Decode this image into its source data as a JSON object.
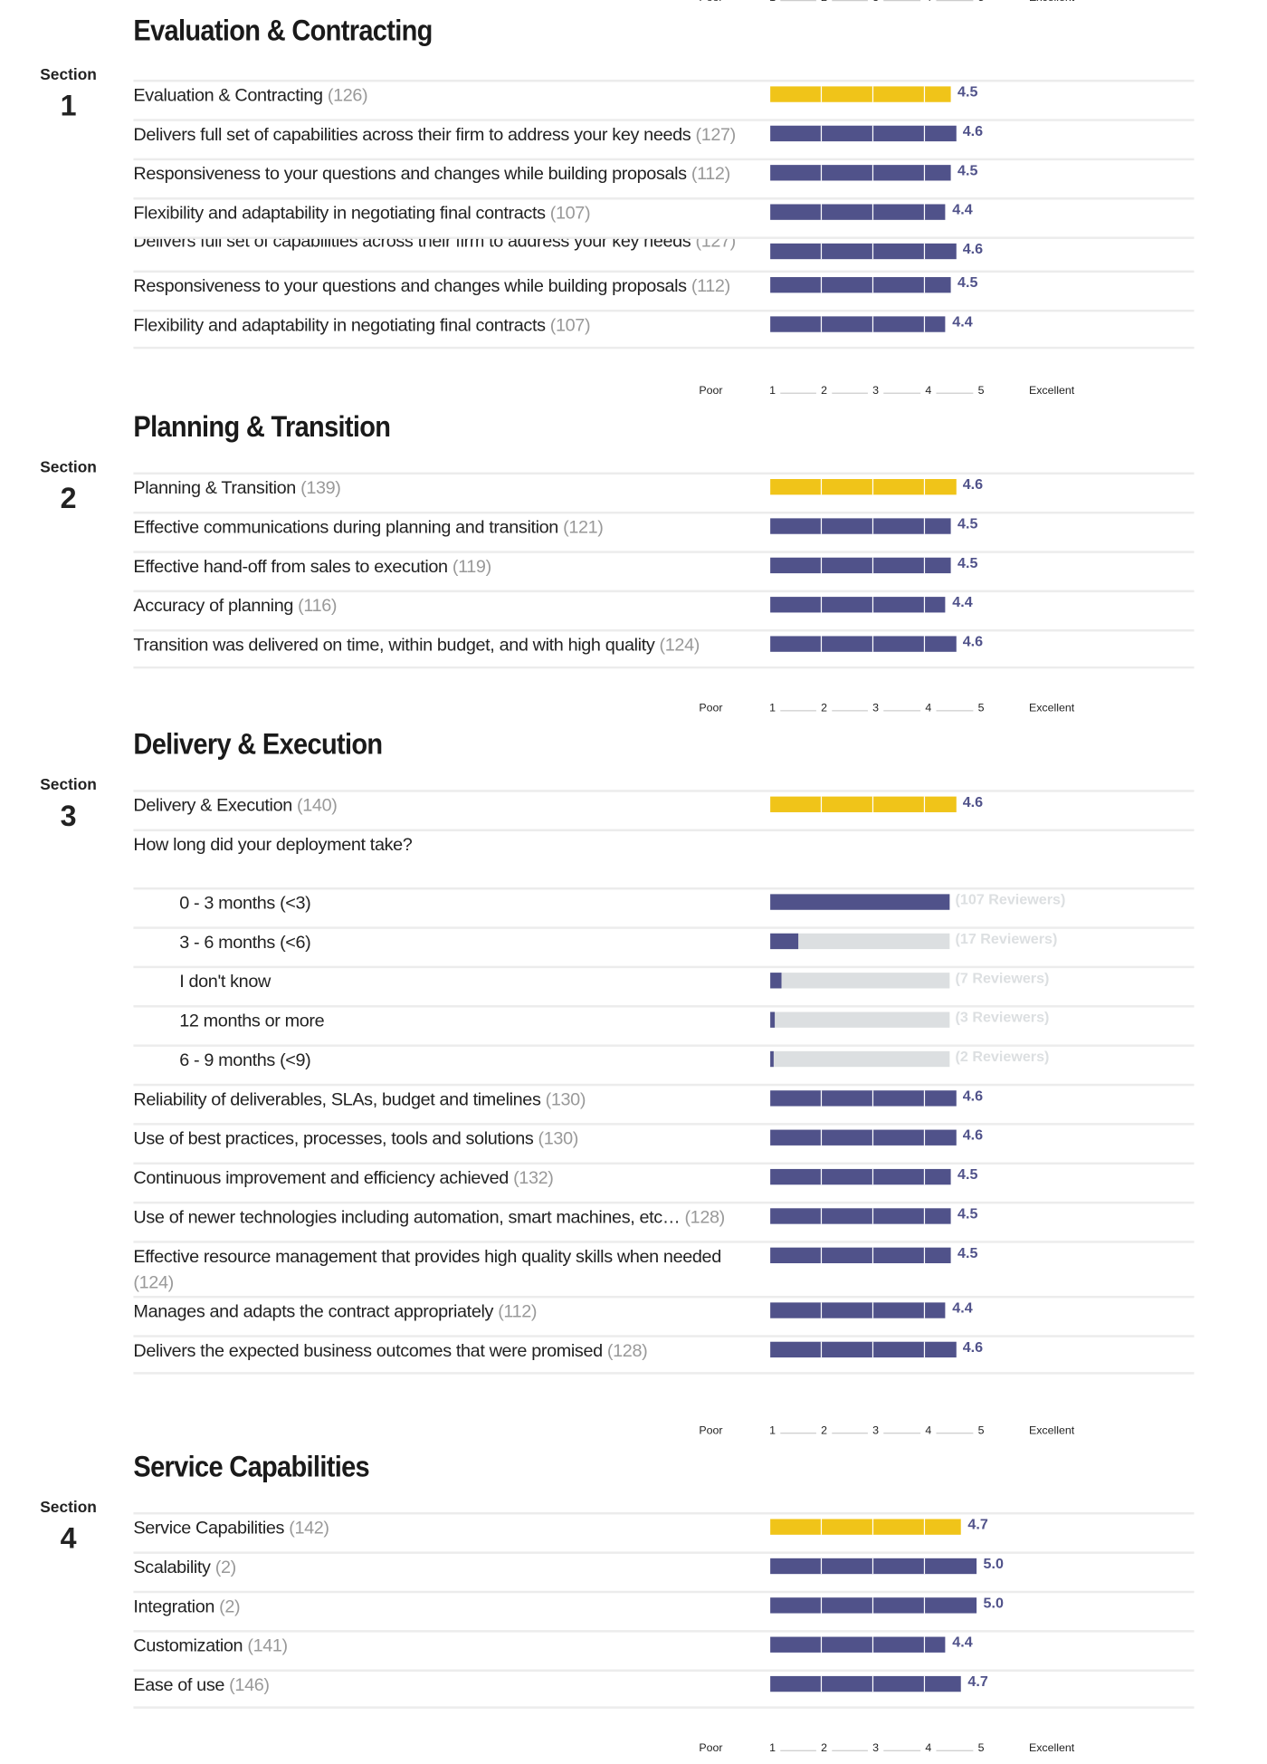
{
  "colors": {
    "summary_bar": "#f0c419",
    "item_bar": "#50528a",
    "track": "#dcdfe1"
  },
  "scale": {
    "poor": "Poor",
    "excellent": "Excellent",
    "ticks": [
      "1",
      "2",
      "3",
      "4",
      "5"
    ]
  },
  "sections": [
    {
      "label": "Section",
      "number": "1",
      "title": "Evaluation & Contracting",
      "rows": [
        {
          "type": "summary",
          "label": "Evaluation & Contracting",
          "count": "(126)",
          "value": 4.5
        },
        {
          "type": "rating",
          "label": "Delivers full set of capabilities across their firm to address your key needs",
          "count": "(127)",
          "value": 4.6
        },
        {
          "type": "rating",
          "label": "Responsiveness to your questions and changes while building proposals",
          "count": "(112)",
          "value": 4.5
        },
        {
          "type": "rating",
          "label": "Flexibility and adaptability in negotiating final contracts",
          "count": "(107)",
          "value": 4.4
        },
        {
          "type": "rating",
          "label": "Delivers full set of capabilities across their firm to address your key needs",
          "count": "(127)",
          "value": 4.6
        },
        {
          "type": "rating",
          "label": "Responsiveness to your questions and changes while building proposals",
          "count": "(112)",
          "value": 4.5
        },
        {
          "type": "rating",
          "label": "Flexibility and adaptability in negotiating final contracts",
          "count": "(107)",
          "value": 4.4
        }
      ]
    },
    {
      "label": "Section",
      "number": "2",
      "title": "Planning & Transition",
      "rows": [
        {
          "type": "summary",
          "label": "Planning & Transition",
          "count": "(139)",
          "value": 4.6
        },
        {
          "type": "rating",
          "label": "Effective communications during planning and transition",
          "count": "(121)",
          "value": 4.5
        },
        {
          "type": "rating",
          "label": "Effective hand-off from sales to execution",
          "count": "(119)",
          "value": 4.5
        },
        {
          "type": "rating",
          "label": "Accuracy of planning",
          "count": "(116)",
          "value": 4.4
        },
        {
          "type": "rating",
          "label": "Transition was delivered on time, within budget, and with high quality",
          "count": "(124)",
          "value": 4.6
        }
      ]
    },
    {
      "label": "Section",
      "number": "3",
      "title": "Delivery & Execution",
      "rows": [
        {
          "type": "summary",
          "label": "Delivery & Execution",
          "count": "(140)",
          "value": 4.6
        },
        {
          "type": "question",
          "label": "How long did your deployment take?"
        },
        {
          "type": "option",
          "label": "0 - 3 months (<3)",
          "reviewers": 107,
          "reviewers_label": "(107 Reviewers)"
        },
        {
          "type": "option",
          "label": "3 - 6 months (<6)",
          "reviewers": 17,
          "reviewers_label": "(17 Reviewers)"
        },
        {
          "type": "option",
          "label": "I don't know",
          "reviewers": 7,
          "reviewers_label": "(7 Reviewers)"
        },
        {
          "type": "option",
          "label": "12 months or more",
          "reviewers": 3,
          "reviewers_label": "(3 Reviewers)"
        },
        {
          "type": "option",
          "label": "6 - 9 months (<9)",
          "reviewers": 2,
          "reviewers_label": "(2 Reviewers)"
        },
        {
          "type": "rating",
          "label": "Reliability of deliverables, SLAs, budget and timelines",
          "count": "(130)",
          "value": 4.6
        },
        {
          "type": "rating",
          "label": "Use of best practices, processes, tools and solutions",
          "count": "(130)",
          "value": 4.6
        },
        {
          "type": "rating",
          "label": "Continuous improvement and efficiency achieved",
          "count": "(132)",
          "value": 4.5
        },
        {
          "type": "rating",
          "label": "Use of newer technologies including automation, smart machines, etc…",
          "count": "(128)",
          "value": 4.5
        },
        {
          "type": "rating",
          "label": "Effective resource management that provides high quality skills when needed",
          "count": "(124)",
          "value": 4.5
        },
        {
          "type": "rating",
          "label": "Manages and adapts the contract appropriately",
          "count": "(112)",
          "value": 4.4
        },
        {
          "type": "rating",
          "label": "Delivers the expected business outcomes that were promised",
          "count": "(128)",
          "value": 4.6
        }
      ]
    },
    {
      "label": "Section",
      "number": "4",
      "title": "Service Capabilities",
      "rows": [
        {
          "type": "summary",
          "label": "Service Capabilities",
          "count": "(142)",
          "value": 4.7
        },
        {
          "type": "rating",
          "label": "Scalability",
          "count": "(2)",
          "value": 5.0
        },
        {
          "type": "rating",
          "label": "Integration",
          "count": "(2)",
          "value": 5.0
        },
        {
          "type": "rating",
          "label": "Customization",
          "count": "(141)",
          "value": 4.4
        },
        {
          "type": "rating",
          "label": "Ease of use",
          "count": "(146)",
          "value": 4.7
        }
      ]
    }
  ]
}
